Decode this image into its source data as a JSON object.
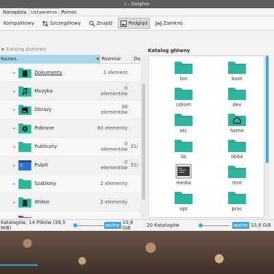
{
  "window": {
    "title": "/ – Dolphin"
  },
  "menu": [
    "Narzędzia",
    "Ustawienia",
    "Pomoc"
  ],
  "toolbar": [
    {
      "label": "Kompaktowy",
      "icon": "compact-view-icon",
      "active": false
    },
    {
      "label": "Szczegółowy",
      "icon": "details-view-icon",
      "active": false
    },
    {
      "label": "Znajdź",
      "icon": "search-icon",
      "active": false
    },
    {
      "label": "Podgląd",
      "icon": "preview-icon",
      "active": true
    },
    {
      "label": "Zamknij",
      "icon": "split-close-icon",
      "active": false
    }
  ],
  "left": {
    "breadcrumb": "Katalog domowy",
    "columns": {
      "name": "Nazwa",
      "size": "Rozmiar",
      "date": "Dat"
    },
    "rows": [
      {
        "name": "Dokumenty",
        "size": "1 element",
        "date": "",
        "icon": "documents-folder-icon"
      },
      {
        "name": "Muzyka",
        "size": "0 elementów",
        "date": "",
        "icon": "music-folder-icon"
      },
      {
        "name": "Obrazy",
        "size": "38 elementów",
        "date": "",
        "icon": "pictures-folder-icon"
      },
      {
        "name": "Pobrane",
        "size": "83 elementy",
        "date": "",
        "icon": "downloads-folder-icon"
      },
      {
        "name": "Publiczny",
        "size": "0 elementów",
        "date": "31/",
        "icon": "public-folder-icon"
      },
      {
        "name": "Pulpit",
        "size": "0 elementów",
        "date": "31/",
        "icon": "desktop-folder-icon"
      },
      {
        "name": "Szablony",
        "size": "2 elementy",
        "date": "",
        "icon": "templates-folder-icon"
      },
      {
        "name": "Wideo",
        "size": "2 elementy",
        "date": "",
        "icon": "video-folder-icon"
      }
    ],
    "status": "Katalogów, 14 Plików (39,5 MiB)",
    "free_space": "wolne",
    "total_space": "10,8 GiB"
  },
  "right": {
    "title": "Katalog główny",
    "items": [
      {
        "name": "bin",
        "icon": "folder-icon"
      },
      {
        "name": "boot",
        "icon": "folder-icon"
      },
      {
        "name": "cdrom",
        "icon": "folder-icon"
      },
      {
        "name": "dev",
        "icon": "folder-icon"
      },
      {
        "name": "etc",
        "icon": "folder-icon"
      },
      {
        "name": "home",
        "icon": "home-folder-icon"
      },
      {
        "name": "lib",
        "icon": "folder-icon"
      },
      {
        "name": "lib64",
        "icon": "folder-icon"
      },
      {
        "name": "media",
        "icon": "media-folder-icon"
      },
      {
        "name": "mnt",
        "icon": "folder-icon"
      },
      {
        "name": "opt",
        "icon": "folder-icon"
      },
      {
        "name": "proc",
        "icon": "folder-icon"
      }
    ],
    "status": "20 Katalogów",
    "free_space": "wolne",
    "total_space": "10,8 GiB"
  },
  "colors": {
    "folder": "#2eb5a0",
    "accent": "#3da7e3",
    "titlebar": "#5d5d5d"
  }
}
